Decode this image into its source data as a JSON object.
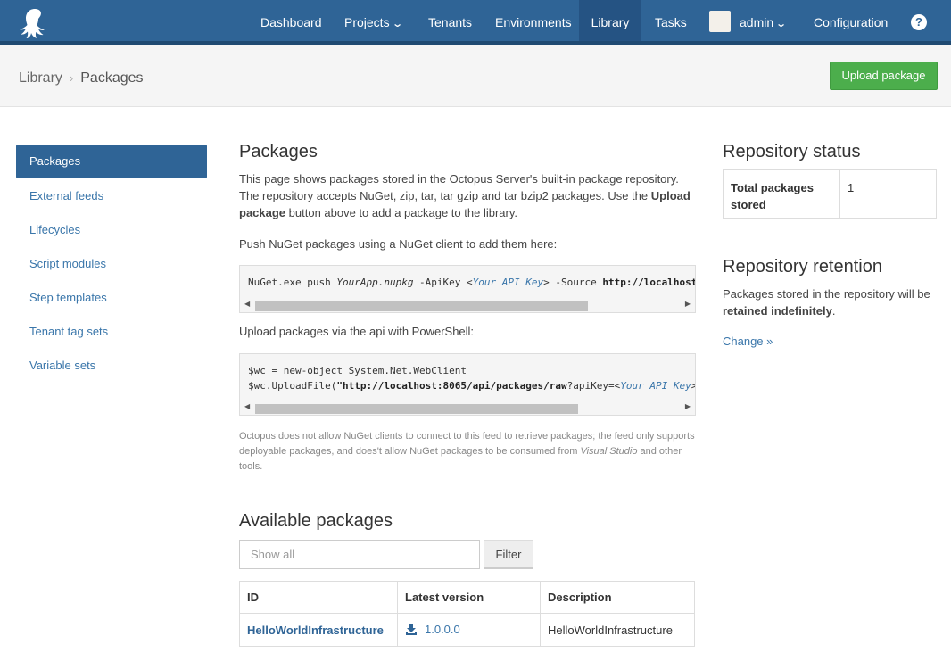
{
  "nav": {
    "items": [
      "Dashboard",
      "Projects",
      "Tenants",
      "Environments",
      "Library",
      "Tasks",
      "admin",
      "Configuration"
    ],
    "active": "Library",
    "help_glyph": "?"
  },
  "breadcrumb": {
    "parent": "Library",
    "separator": "›",
    "current": "Packages"
  },
  "upload_button": "Upload package",
  "sidebar": {
    "items": [
      "Packages",
      "External feeds",
      "Lifecycles",
      "Script modules",
      "Step templates",
      "Tenant tag sets",
      "Variable sets"
    ],
    "active": "Packages"
  },
  "main": {
    "title": "Packages",
    "intro_part1": "This page shows packages stored in the Octopus Server's built-in package repository. The repository accepts NuGet, zip, tar, tar gzip and tar bzip2 packages. Use the ",
    "intro_bold": "Upload package",
    "intro_part2": " button above to add a package to the library.",
    "push_label": "Push NuGet packages using a NuGet client to add them here:",
    "nuget_cmd": {
      "a": "NuGet.exe push ",
      "pkg": "YourApp.nupkg",
      "b": " -ApiKey <",
      "key": "Your API Key",
      "c": "> -Source ",
      "url": "http://localhost"
    },
    "ps_label": "Upload packages via the api with PowerShell:",
    "ps_cmd": {
      "line1": "$wc = new-object System.Net.WebClient",
      "a": "$wc.UploadFile(",
      "url": "\"http://localhost:8065/api/packages/raw",
      "b": "?apiKey=<",
      "key": "Your API Key",
      "c": ">"
    },
    "note_part1": "Octopus does not allow NuGet clients to connect to this feed to retrieve packages; the feed only supports deployable packages, and does't allow NuGet packages to be consumed from ",
    "note_italic": "Visual Studio",
    "note_part2": " and other tools.",
    "available_title": "Available packages",
    "filter_placeholder": "Show all",
    "filter_button": "Filter",
    "table": {
      "headers": [
        "ID",
        "Latest version",
        "Description"
      ],
      "rows": [
        {
          "id": "HelloWorldInfrastructure",
          "version": "1.0.0.0",
          "description": "HelloWorldInfrastructure"
        }
      ]
    }
  },
  "right": {
    "status_title": "Repository status",
    "status_key": "Total packages stored",
    "status_value": "1",
    "retention_title": "Repository retention",
    "retention_part1": "Packages stored in the repository will be ",
    "retention_bold": "retained indefinitely",
    "retention_part2": ".",
    "change_link": "Change »"
  },
  "colors": {
    "nav_bg": "#2f6496",
    "accent": "#3a76aa",
    "success": "#4cae4c"
  }
}
